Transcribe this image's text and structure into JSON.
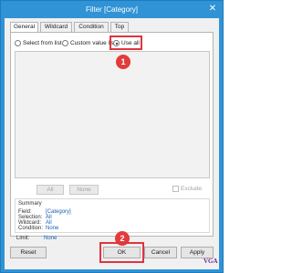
{
  "window": {
    "title": "Filter [Category]",
    "close_glyph": "✕"
  },
  "tabs": [
    {
      "label": "General",
      "active": true
    },
    {
      "label": "Wildcard",
      "active": false
    },
    {
      "label": "Condition",
      "active": false
    },
    {
      "label": "Top",
      "active": false
    }
  ],
  "selection_mode": {
    "options": [
      {
        "label": "Select from list",
        "selected": false
      },
      {
        "label": "Custom value list",
        "selected": false
      },
      {
        "label": "Use all",
        "selected": true
      }
    ]
  },
  "list_buttons": {
    "all_label": "All",
    "none_label": "None",
    "exclude_label": "Exclude",
    "exclude_checked": false
  },
  "summary": {
    "title": "Summary",
    "rows": [
      {
        "label": "Field:",
        "value": "[Category]"
      },
      {
        "label": "Selection:",
        "value": "All"
      },
      {
        "label": "Wildcard:",
        "value": "All"
      },
      {
        "label": "Condition:",
        "value": "None"
      },
      {
        "label": "Limit:",
        "value": "None"
      }
    ]
  },
  "footer": {
    "reset_label": "Reset",
    "ok_label": "OK",
    "cancel_label": "Cancel",
    "apply_label": "Apply"
  },
  "annotations": {
    "step1": "1",
    "step2": "2",
    "highlight_color": "#e0343f"
  },
  "watermark": "VGA"
}
